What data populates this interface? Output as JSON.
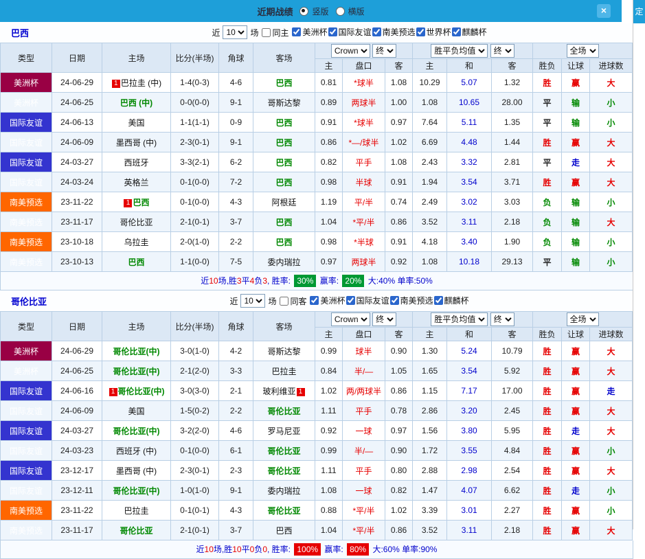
{
  "titlebar": {
    "title": "近期战绩",
    "layout_options": [
      {
        "label": "竖版",
        "selected": true
      },
      {
        "label": "横版",
        "selected": false
      }
    ],
    "close_label": "×"
  },
  "side_panel": {
    "text": "定"
  },
  "table_header": {
    "cols": [
      "类型",
      "日期",
      "主场",
      "比分(半场)",
      "角球",
      "客场"
    ],
    "odds_group": [
      "主",
      "盘口",
      "客"
    ],
    "wdl_group": [
      "主",
      "和",
      "客"
    ],
    "result_group": [
      "胜负",
      "让球",
      "进球数"
    ],
    "selects": {
      "source": "Crown",
      "final1": "终",
      "wdl_avg": "胜平负均值",
      "final2": "终",
      "scope": "全场"
    }
  },
  "sections": [
    {
      "team": "巴西",
      "filter": {
        "near_label": "近",
        "near_value": "10",
        "games_label": "场",
        "same": {
          "label": "同主",
          "checked": false
        },
        "competitions": [
          {
            "label": "美洲杯",
            "checked": true
          },
          {
            "label": "国际友谊",
            "checked": true
          },
          {
            "label": "南美预选",
            "checked": true
          },
          {
            "label": "世界杯",
            "checked": true
          },
          {
            "label": "麒麟杯",
            "checked": true
          }
        ]
      },
      "rows": [
        {
          "type": "美洲杯",
          "date": "24-06-29",
          "home": "巴拉圭 (中)",
          "home_badge": "1",
          "score": "1-4(0-3)",
          "corners": "4-6",
          "away": "巴西",
          "away_tracked": true,
          "ah_home": "0.81",
          "handicap": "*球半",
          "ah_away": "1.08",
          "win": "10.29",
          "draw": "5.07",
          "lose": "1.32",
          "result": "胜",
          "ah_result": "赢",
          "goals": "大"
        },
        {
          "type": "美洲杯",
          "date": "24-06-25",
          "home": "巴西 (中)",
          "home_tracked": true,
          "score": "0-0(0-0)",
          "corners": "9-1",
          "away": "哥斯达黎",
          "ah_home": "0.89",
          "handicap": "两球半",
          "ah_away": "1.00",
          "win": "1.08",
          "draw": "10.65",
          "lose": "28.00",
          "result": "平",
          "ah_result": "输",
          "goals": "小"
        },
        {
          "type": "国际友谊",
          "date": "24-06-13",
          "home": "美国",
          "score": "1-1(1-1)",
          "corners": "0-9",
          "away": "巴西",
          "away_tracked": true,
          "ah_home": "0.91",
          "handicap": "*球半",
          "ah_away": "0.97",
          "win": "7.64",
          "draw": "5.11",
          "lose": "1.35",
          "result": "平",
          "ah_result": "输",
          "goals": "小"
        },
        {
          "type": "国际友谊",
          "date": "24-06-09",
          "home": "墨西哥 (中)",
          "score": "2-3(0-1)",
          "corners": "9-1",
          "away": "巴西",
          "away_tracked": true,
          "ah_home": "0.86",
          "handicap": "*—/球半",
          "ah_away": "1.02",
          "win": "6.69",
          "draw": "4.48",
          "lose": "1.44",
          "result": "胜",
          "ah_result": "赢",
          "goals": "大"
        },
        {
          "type": "国际友谊",
          "date": "24-03-27",
          "home": "西班牙",
          "score": "3-3(2-1)",
          "corners": "6-2",
          "away": "巴西",
          "away_tracked": true,
          "ah_home": "0.82",
          "handicap": "平手",
          "ah_away": "1.08",
          "win": "2.43",
          "draw": "3.32",
          "lose": "2.81",
          "result": "平",
          "ah_result": "走",
          "goals": "大"
        },
        {
          "type": "国际友谊",
          "date": "24-03-24",
          "home": "英格兰",
          "score": "0-1(0-0)",
          "corners": "7-2",
          "away": "巴西",
          "away_tracked": true,
          "ah_home": "0.98",
          "handicap": "半球",
          "ah_away": "0.91",
          "win": "1.94",
          "draw": "3.54",
          "lose": "3.71",
          "result": "胜",
          "ah_result": "赢",
          "goals": "大"
        },
        {
          "type": "南美预选",
          "date": "23-11-22",
          "home": "巴西",
          "home_badge": "1",
          "home_tracked": true,
          "score": "0-1(0-0)",
          "corners": "4-3",
          "away": "阿根廷",
          "ah_home": "1.19",
          "handicap": "平/半",
          "ah_away": "0.74",
          "win": "2.49",
          "draw": "3.02",
          "lose": "3.03",
          "result": "负",
          "ah_result": "输",
          "goals": "小"
        },
        {
          "type": "南美预选",
          "date": "23-11-17",
          "home": "哥伦比亚",
          "score": "2-1(0-1)",
          "corners": "3-7",
          "away": "巴西",
          "away_tracked": true,
          "ah_home": "1.04",
          "handicap": "*平/半",
          "ah_away": "0.86",
          "win": "3.52",
          "draw": "3.11",
          "lose": "2.18",
          "result": "负",
          "ah_result": "输",
          "goals": "大"
        },
        {
          "type": "南美预选",
          "date": "23-10-18",
          "home": "乌拉圭",
          "score": "2-0(1-0)",
          "corners": "2-2",
          "away": "巴西",
          "away_tracked": true,
          "ah_home": "0.98",
          "handicap": "*半球",
          "ah_away": "0.91",
          "win": "4.18",
          "draw": "3.40",
          "lose": "1.90",
          "result": "负",
          "ah_result": "输",
          "goals": "小"
        },
        {
          "type": "南美预选",
          "date": "23-10-13",
          "home": "巴西",
          "home_tracked": true,
          "score": "1-1(0-0)",
          "corners": "7-5",
          "away": "委内瑞拉",
          "ah_home": "0.97",
          "handicap": "两球半",
          "ah_away": "0.92",
          "win": "1.08",
          "draw": "10.18",
          "lose": "29.13",
          "result": "平",
          "ah_result": "输",
          "goals": "小"
        }
      ],
      "summary": {
        "lead_parts": [
          [
            "近",
            "t"
          ],
          [
            "10",
            "n"
          ],
          [
            "场,胜",
            "t"
          ],
          [
            "3",
            "n"
          ],
          [
            "平",
            "t"
          ],
          [
            "4",
            "n"
          ],
          [
            "负",
            "t"
          ],
          [
            "3",
            "n"
          ],
          [
            ",",
            "t"
          ]
        ],
        "win_label": "胜率:",
        "win_rate": "30%",
        "win_color": "green",
        "ah_label": "赢率:",
        "ah_rate": "20%",
        "ah_color": "green",
        "tail": "大:40% 单率:50%"
      }
    },
    {
      "team": "哥伦比亚",
      "filter": {
        "near_label": "近",
        "near_value": "10",
        "games_label": "场",
        "same": {
          "label": "同客",
          "checked": false
        },
        "competitions": [
          {
            "label": "美洲杯",
            "checked": true
          },
          {
            "label": "国际友谊",
            "checked": true
          },
          {
            "label": "南美预选",
            "checked": true
          },
          {
            "label": "麒麟杯",
            "checked": true
          }
        ]
      },
      "rows": [
        {
          "type": "美洲杯",
          "date": "24-06-29",
          "home": "哥伦比亚(中)",
          "home_tracked": true,
          "score": "3-0(1-0)",
          "corners": "4-2",
          "away": "哥斯达黎",
          "ah_home": "0.99",
          "handicap": "球半",
          "ah_away": "0.90",
          "win": "1.30",
          "draw": "5.24",
          "lose": "10.79",
          "result": "胜",
          "ah_result": "赢",
          "goals": "大"
        },
        {
          "type": "美洲杯",
          "date": "24-06-25",
          "home": "哥伦比亚(中)",
          "home_tracked": true,
          "score": "2-1(2-0)",
          "corners": "3-3",
          "away": "巴拉圭",
          "ah_home": "0.84",
          "handicap": "半/—",
          "ah_away": "1.05",
          "win": "1.65",
          "draw": "3.54",
          "lose": "5.92",
          "result": "胜",
          "ah_result": "赢",
          "goals": "大"
        },
        {
          "type": "国际友谊",
          "date": "24-06-16",
          "home": "哥伦比亚(中)",
          "home_badge": "1",
          "home_tracked": true,
          "score": "3-0(3-0)",
          "corners": "2-1",
          "away": "玻利维亚",
          "away_badge": "1",
          "ah_home": "1.02",
          "handicap": "两/两球半",
          "ah_away": "0.86",
          "win": "1.15",
          "draw": "7.17",
          "lose": "17.00",
          "result": "胜",
          "ah_result": "赢",
          "goals": "走"
        },
        {
          "type": "国际友谊",
          "date": "24-06-09",
          "home": "美国",
          "score": "1-5(0-2)",
          "corners": "2-2",
          "away": "哥伦比亚",
          "away_tracked": true,
          "ah_home": "1.11",
          "handicap": "平手",
          "ah_away": "0.78",
          "win": "2.86",
          "draw": "3.20",
          "lose": "2.45",
          "result": "胜",
          "ah_result": "赢",
          "goals": "大"
        },
        {
          "type": "国际友谊",
          "date": "24-03-27",
          "home": "哥伦比亚(中)",
          "home_tracked": true,
          "score": "3-2(2-0)",
          "corners": "4-6",
          "away": "罗马尼亚",
          "ah_home": "0.92",
          "handicap": "一球",
          "ah_away": "0.97",
          "win": "1.56",
          "draw": "3.80",
          "lose": "5.95",
          "result": "胜",
          "ah_result": "走",
          "goals": "大"
        },
        {
          "type": "国际友谊",
          "date": "24-03-23",
          "home": "西班牙 (中)",
          "score": "0-1(0-0)",
          "corners": "6-1",
          "away": "哥伦比亚",
          "away_tracked": true,
          "ah_home": "0.99",
          "handicap": "半/—",
          "ah_away": "0.90",
          "win": "1.72",
          "draw": "3.55",
          "lose": "4.84",
          "result": "胜",
          "ah_result": "赢",
          "goals": "小"
        },
        {
          "type": "国际友谊",
          "date": "23-12-17",
          "home": "墨西哥 (中)",
          "score": "2-3(0-1)",
          "corners": "2-3",
          "away": "哥伦比亚",
          "away_tracked": true,
          "ah_home": "1.11",
          "handicap": "平手",
          "ah_away": "0.80",
          "win": "2.88",
          "draw": "2.98",
          "lose": "2.54",
          "result": "胜",
          "ah_result": "赢",
          "goals": "大"
        },
        {
          "type": "国际友谊",
          "date": "23-12-11",
          "home": "哥伦比亚(中)",
          "home_tracked": true,
          "score": "1-0(1-0)",
          "corners": "9-1",
          "away": "委内瑞拉",
          "ah_home": "1.08",
          "handicap": "一球",
          "ah_away": "0.82",
          "win": "1.47",
          "draw": "4.07",
          "lose": "6.62",
          "result": "胜",
          "ah_result": "走",
          "goals": "小"
        },
        {
          "type": "南美预选",
          "date": "23-11-22",
          "home": "巴拉圭",
          "score": "0-1(0-1)",
          "corners": "4-3",
          "away": "哥伦比亚",
          "away_tracked": true,
          "ah_home": "0.88",
          "handicap": "*平/半",
          "ah_away": "1.02",
          "win": "3.39",
          "draw": "3.01",
          "lose": "2.27",
          "result": "胜",
          "ah_result": "赢",
          "goals": "小"
        },
        {
          "type": "南美预选",
          "date": "23-11-17",
          "home": "哥伦比亚",
          "home_tracked": true,
          "score": "2-1(0-1)",
          "corners": "3-7",
          "away": "巴西",
          "ah_home": "1.04",
          "handicap": "*平/半",
          "ah_away": "0.86",
          "win": "3.52",
          "draw": "3.11",
          "lose": "2.18",
          "result": "胜",
          "ah_result": "赢",
          "goals": "大"
        }
      ],
      "summary": {
        "lead_parts": [
          [
            "近",
            "t"
          ],
          [
            "10",
            "n"
          ],
          [
            "场,胜",
            "t"
          ],
          [
            "10",
            "n"
          ],
          [
            "平",
            "t"
          ],
          [
            "0",
            "n"
          ],
          [
            "负",
            "t"
          ],
          [
            "0",
            "n"
          ],
          [
            ",",
            "t"
          ]
        ],
        "win_label": "胜率:",
        "win_rate": "100%",
        "win_color": "red",
        "ah_label": "赢率:",
        "ah_rate": "80%",
        "ah_color": "red",
        "tail": "大:60% 单率:90%"
      }
    }
  ]
}
